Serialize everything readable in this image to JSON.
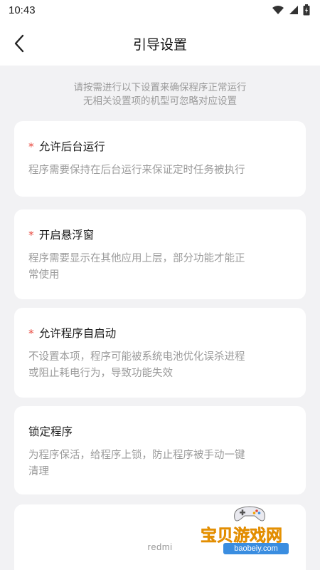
{
  "status_bar": {
    "time": "10:43",
    "icons": [
      "wifi-icon",
      "signal-icon",
      "battery-icon"
    ]
  },
  "header": {
    "title": "引导设置",
    "back_icon": "chevron-left-icon"
  },
  "intro": {
    "line1": "请按需进行以下设置来确保程序正常运行",
    "line2": "无相关设置项的机型可忽略对应设置"
  },
  "settings": [
    {
      "required": true,
      "required_mark": "*",
      "title": "允许后台运行",
      "desc_lines": [
        "程序需要保持在后台运行来保证定时任务被执行"
      ]
    },
    {
      "required": true,
      "required_mark": "*",
      "title": "开启悬浮窗",
      "desc_lines": [
        "程序需要显示在其他应用上层，部分功能才能正",
        "常使用"
      ]
    },
    {
      "required": true,
      "required_mark": "*",
      "title": "允许程序自启动",
      "desc_lines": [
        "不设置本项，程序可能被系统电池优化误杀进程",
        "或阻止耗电行为，导致功能失效"
      ]
    },
    {
      "required": false,
      "title": "锁定程序",
      "desc_lines": [
        "为程序保活，给程序上锁，防止程序被手动一键",
        "清理"
      ]
    }
  ],
  "footer": {
    "brand": "redmi"
  },
  "watermark": {
    "text": "宝贝游戏网",
    "url": "baobeiy.com"
  },
  "colors": {
    "accent_required": "#e8483e",
    "background": "#f2f2f4",
    "card": "#ffffff",
    "muted_text": "#9b9b9b"
  }
}
